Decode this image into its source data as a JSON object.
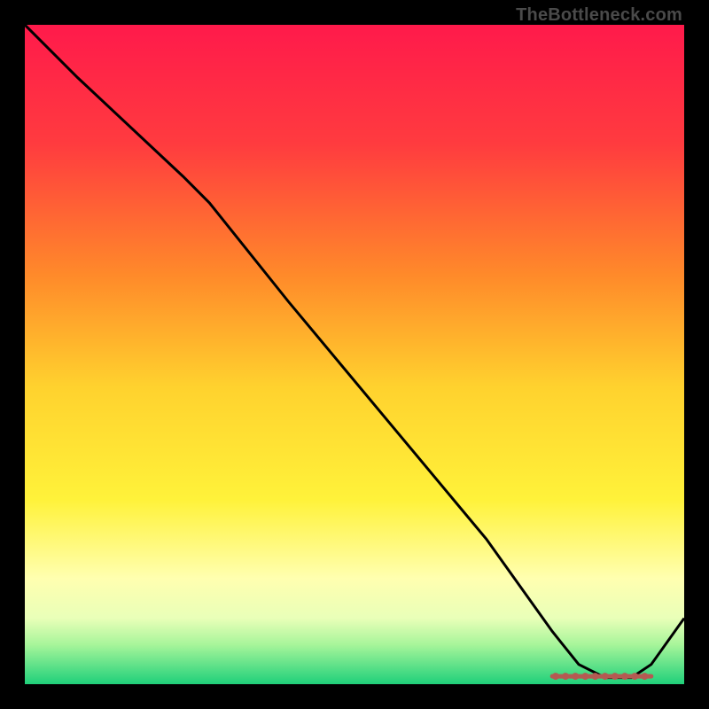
{
  "watermark": "TheBottleneck.com",
  "chart_data": {
    "type": "line",
    "title": "",
    "xlabel": "",
    "ylabel": "",
    "xlim": [
      0,
      100
    ],
    "ylim": [
      0,
      100
    ],
    "gradient_stops": [
      {
        "offset": 0,
        "color": "#ff1a4b"
      },
      {
        "offset": 18,
        "color": "#ff3b3f"
      },
      {
        "offset": 38,
        "color": "#ff8a2a"
      },
      {
        "offset": 55,
        "color": "#ffd22e"
      },
      {
        "offset": 72,
        "color": "#fff23a"
      },
      {
        "offset": 84,
        "color": "#ffffb0"
      },
      {
        "offset": 90,
        "color": "#e9ffb8"
      },
      {
        "offset": 94,
        "color": "#a7f59a"
      },
      {
        "offset": 100,
        "color": "#1fd07a"
      }
    ],
    "series": [
      {
        "name": "bottleneck-curve",
        "color": "#000000",
        "x": [
          0,
          8,
          24,
          28,
          40,
          55,
          70,
          80,
          84,
          88,
          92,
          95,
          100
        ],
        "values": [
          100,
          92,
          77,
          73,
          58,
          40,
          22,
          8,
          3,
          1,
          1,
          3,
          10
        ]
      }
    ],
    "flat_segment": {
      "color": "#b55a52",
      "x_start": 80,
      "x_end": 95,
      "y": 1.2,
      "dots_x": [
        80.5,
        82,
        83.5,
        85,
        86.5,
        88,
        89.5,
        91,
        92.5,
        94
      ]
    }
  }
}
